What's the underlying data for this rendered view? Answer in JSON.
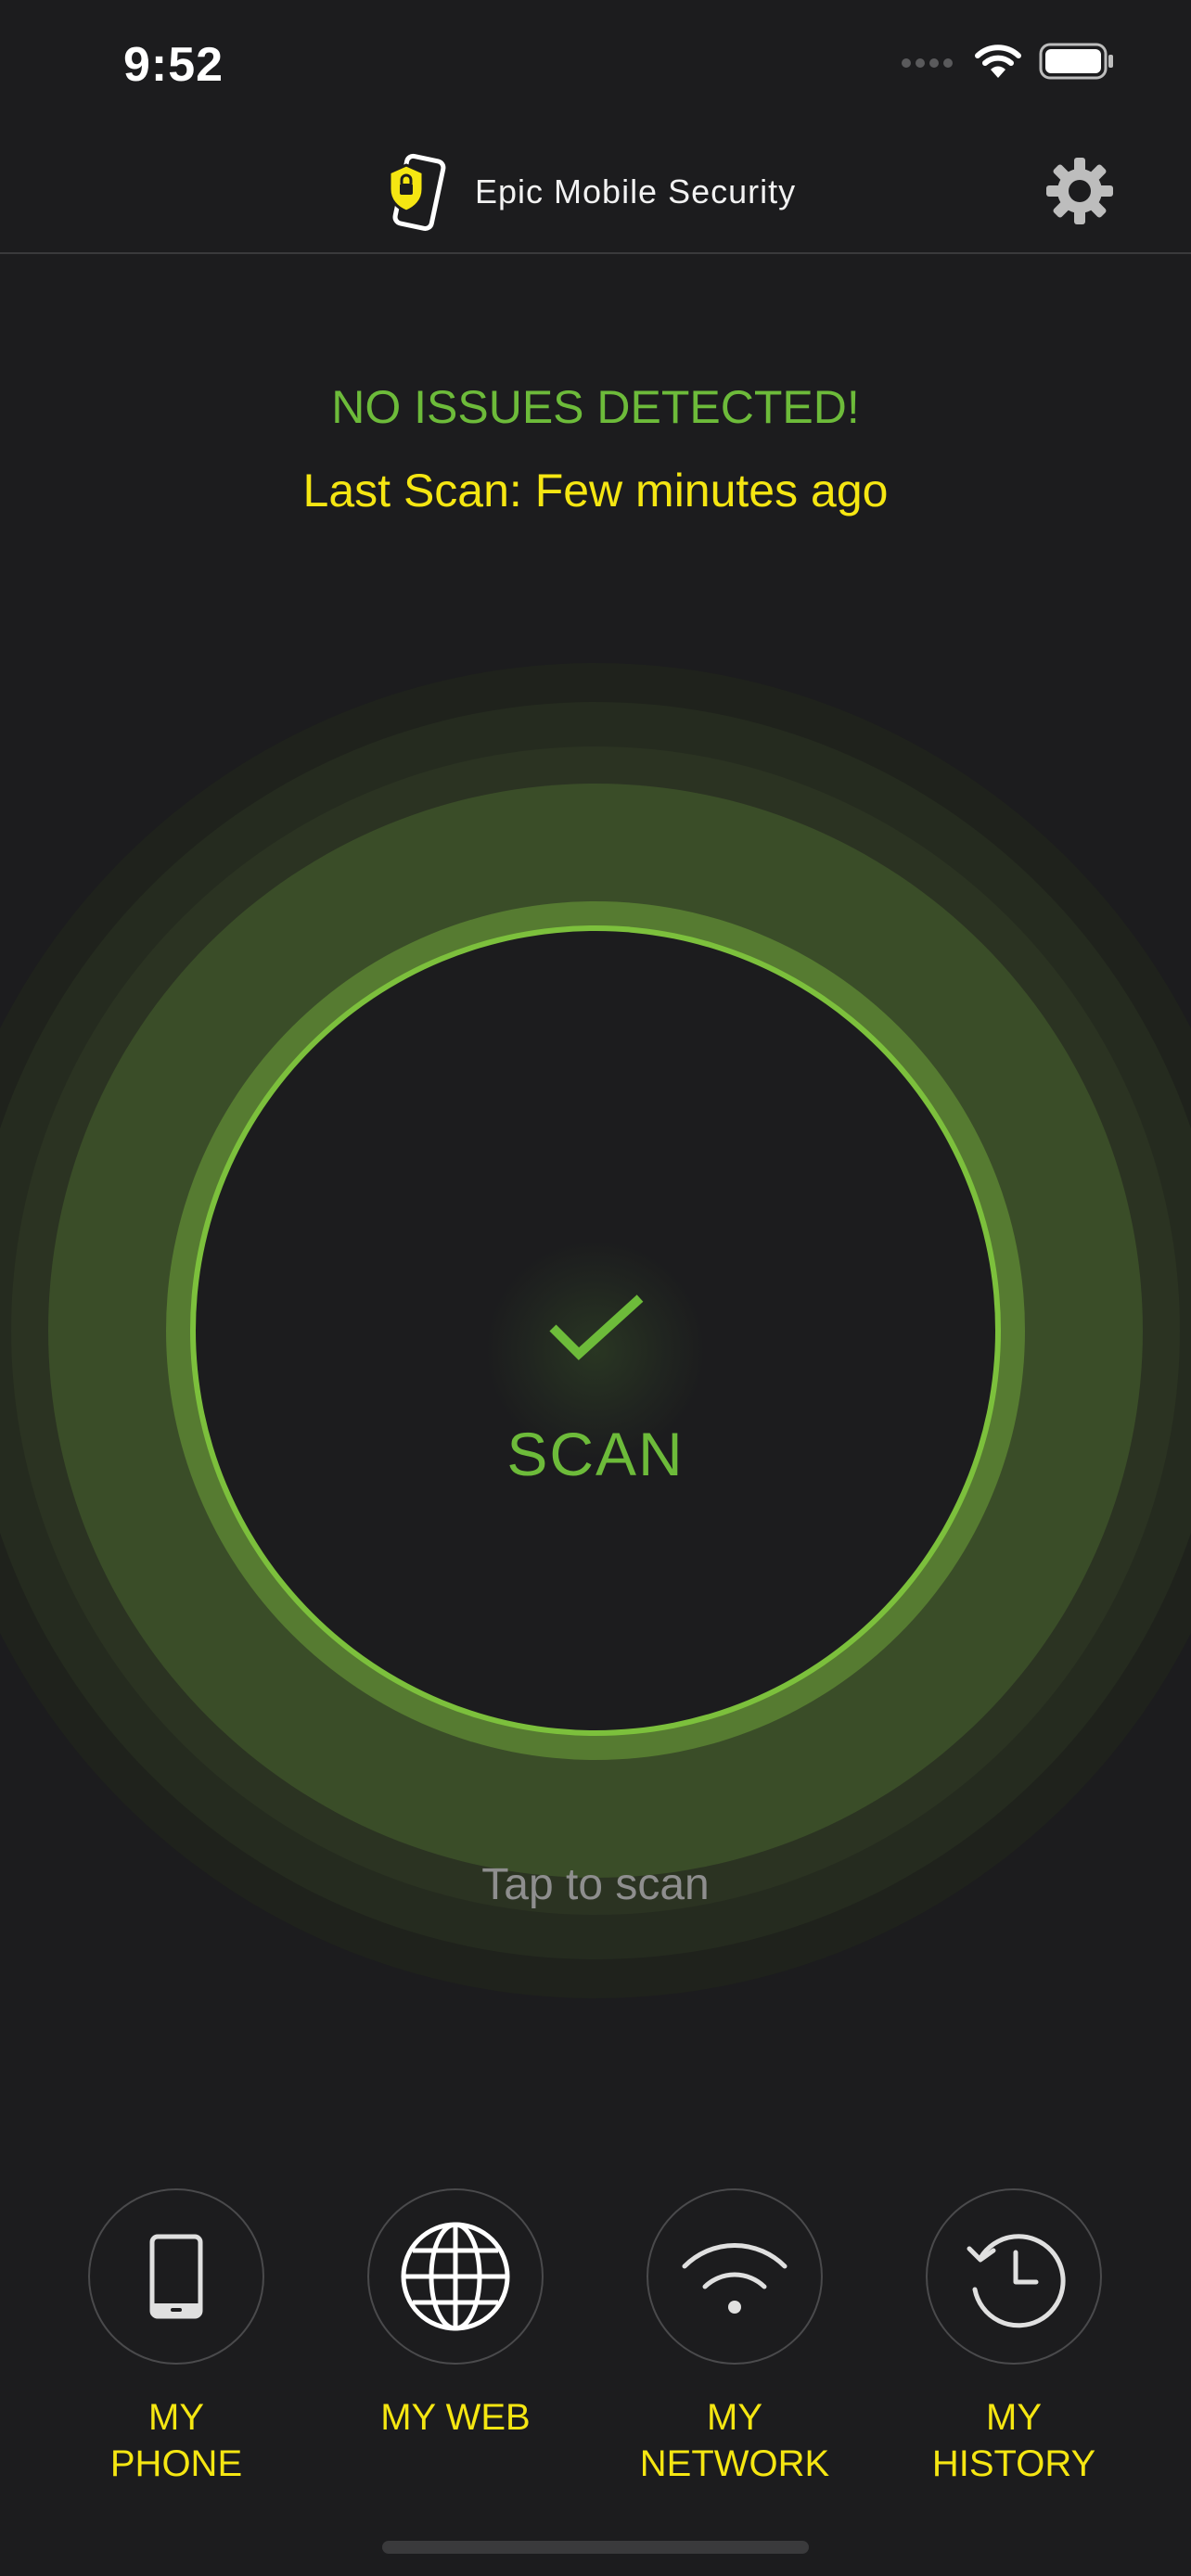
{
  "status_bar": {
    "time": "9:52"
  },
  "header": {
    "title": "Epic Mobile Security"
  },
  "status": {
    "result": "NO ISSUES DETECTED!",
    "last_scan": "Last Scan: Few minutes ago"
  },
  "scan": {
    "label": "SCAN",
    "hint": "Tap to scan"
  },
  "nav": {
    "phone": {
      "line1": "MY",
      "line2": "PHONE",
      "icon": "phone-icon"
    },
    "web": {
      "line1": "MY WEB",
      "icon": "globe-icon"
    },
    "network": {
      "line1": "MY",
      "line2": "NETWORK",
      "icon": "wifi-icon"
    },
    "history": {
      "line1": "MY",
      "line2": "HISTORY",
      "icon": "history-icon"
    }
  },
  "colors": {
    "background": "#1c1c1e",
    "ok_green": "#6dbb3a",
    "accent_yellow": "#f5e612",
    "ring_dark": "#24291f",
    "ring_mid": "#2b3322",
    "ring_band": "#3c4f28",
    "ring_inner": "#54782f",
    "ring_edge": "#7cc03c"
  }
}
